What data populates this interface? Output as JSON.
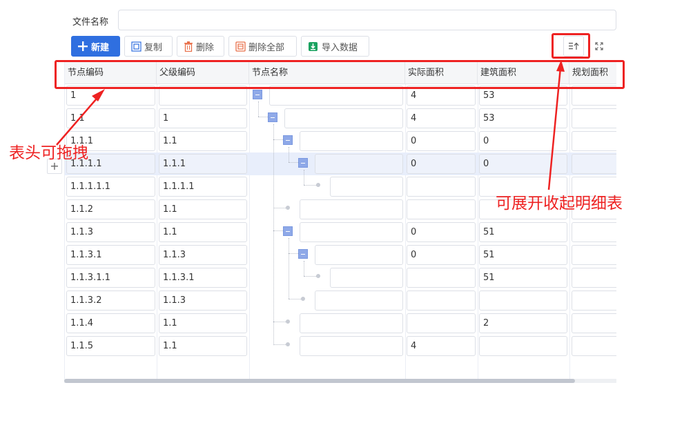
{
  "form": {
    "file_name_label": "文件名称",
    "file_name_value": ""
  },
  "toolbar": {
    "new_label": "新建",
    "copy_label": "复制",
    "delete_label": "删除",
    "delete_all_label": "删除全部",
    "import_label": "导入数据"
  },
  "icons": {
    "expand_collapse": "expand-collapse-icon",
    "fullscreen": "fullscreen-icon",
    "add_row": "plus-icon"
  },
  "colors": {
    "primary": "#2f6fe0",
    "annotation": "#ee2222",
    "tree_toggle": "#8fa9e8",
    "selected_row": "#e8eefb"
  },
  "table": {
    "columns": [
      "节点编码",
      "父级编码",
      "节点名称",
      "实际面积",
      "建筑面积",
      "规划面积"
    ],
    "rows": [
      {
        "code": "1",
        "parent": "",
        "name": "",
        "actual": "4",
        "building": "53",
        "planned": ""
      },
      {
        "code": "1.1",
        "parent": "1",
        "name": "",
        "actual": "4",
        "building": "53",
        "planned": ""
      },
      {
        "code": "1.1.1",
        "parent": "1.1",
        "name": "",
        "actual": "0",
        "building": "0",
        "planned": ""
      },
      {
        "code": "1.1.1.1",
        "parent": "1.1.1",
        "name": "",
        "actual": "0",
        "building": "0",
        "planned": ""
      },
      {
        "code": "1.1.1.1.1",
        "parent": "1.1.1.1",
        "name": "",
        "actual": "",
        "building": "",
        "planned": ""
      },
      {
        "code": "1.1.2",
        "parent": "1.1",
        "name": "",
        "actual": "",
        "building": "",
        "planned": ""
      },
      {
        "code": "1.1.3",
        "parent": "1.1",
        "name": "",
        "actual": "0",
        "building": "51",
        "planned": ""
      },
      {
        "code": "1.1.3.1",
        "parent": "1.1.3",
        "name": "",
        "actual": "0",
        "building": "51",
        "planned": ""
      },
      {
        "code": "1.1.3.1.1",
        "parent": "1.1.3.1",
        "name": "",
        "actual": "",
        "building": "51",
        "planned": ""
      },
      {
        "code": "1.1.3.2",
        "parent": "1.1.3",
        "name": "",
        "actual": "",
        "building": "",
        "planned": ""
      },
      {
        "code": "1.1.4",
        "parent": "1.1",
        "name": "",
        "actual": "",
        "building": "2",
        "planned": ""
      },
      {
        "code": "1.1.5",
        "parent": "1.1",
        "name": "",
        "actual": "4",
        "building": "",
        "planned": ""
      }
    ]
  },
  "annotations": {
    "header_draggable": "表头可拖拽",
    "expand_collapse_detail": "可展开收起明细表"
  }
}
